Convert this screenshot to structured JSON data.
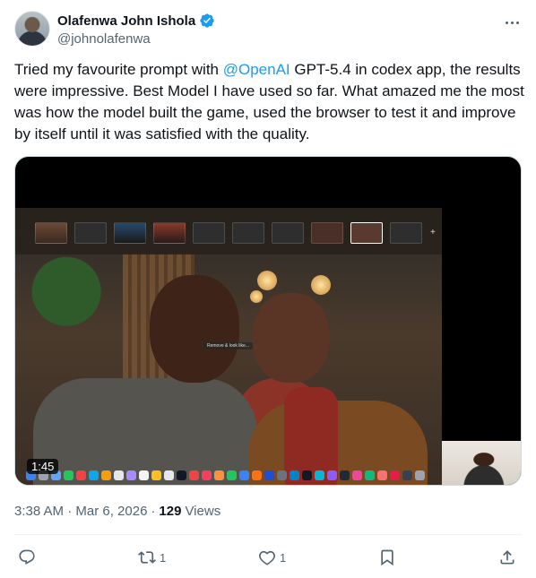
{
  "author": {
    "name": "Olafenwa John Ishola",
    "handle": "@johnolafenwa",
    "verified": true
  },
  "tweet": {
    "text_before_mention": "Tried my favourite prompt with ",
    "mention": "@OpenAI",
    "text_after_mention": " GPT-5.4 in codex app, the results were impressive. Best Model I have used so far. What amazed me the most was how the model built the game, used the browser to test it and improve by itself until it was satisfied with the quality."
  },
  "media": {
    "video_time": "1:45",
    "on_screen_label": "Remove & look like..."
  },
  "meta": {
    "timestamp": "3:38 AM · Mar 6, 2026",
    "separator": "·",
    "views_count": "129",
    "views_label": "Views"
  },
  "actions": {
    "reply_count": "",
    "retweet_count": "1",
    "like_count": "1"
  },
  "colors": {
    "accent": "#1d9bf0",
    "text_primary": "#0f1419",
    "text_secondary": "#536471"
  }
}
